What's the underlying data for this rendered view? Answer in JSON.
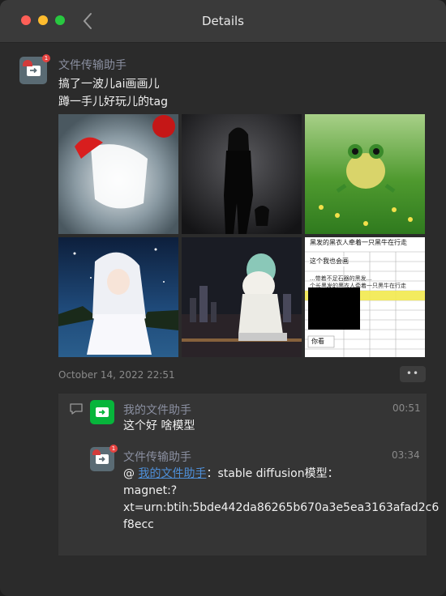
{
  "window": {
    "title": "Details"
  },
  "post": {
    "sender": "文件传输助手",
    "lines": [
      "搞了一波儿ai画画儿",
      "蹲一手儿好玩儿的tag"
    ],
    "images": [
      {
        "name": "portrait-red"
      },
      {
        "name": "man-dark"
      },
      {
        "name": "frog-grass"
      },
      {
        "name": "anime-girl-night"
      },
      {
        "name": "white-lion-city"
      },
      {
        "name": "text-sheet"
      }
    ],
    "timestamp": "October 14, 2022 22:51",
    "more_label": "••"
  },
  "thumb6": {
    "header": "黑发的黑衣人牵着一只黑牛在行走",
    "line1": "这个我也会画",
    "line2": "...带着不足石器的黑发...",
    "line3": "个长黑发的黑衣人牵着一只黑牛在行走",
    "bottom": "你看"
  },
  "comments": [
    {
      "sender": "我的文件助手",
      "time": "00:51",
      "text": "这个好 啥模型"
    },
    {
      "sender": "文件传输助手",
      "time": "03:34",
      "prefix": "@ ",
      "mention": "我的文件助手",
      "text_line1": "：stable diffusion模型：",
      "text_line2": "magnet:?",
      "text_line3": "xt=urn:btih:5bde442da86265b670a3e5ea3163afad2c6",
      "text_line4": "f8ecc"
    }
  ],
  "badge_count": "1",
  "colors": {
    "accent_green": "#07b53b",
    "mention": "#4e8fd8",
    "badge": "#e64340"
  }
}
